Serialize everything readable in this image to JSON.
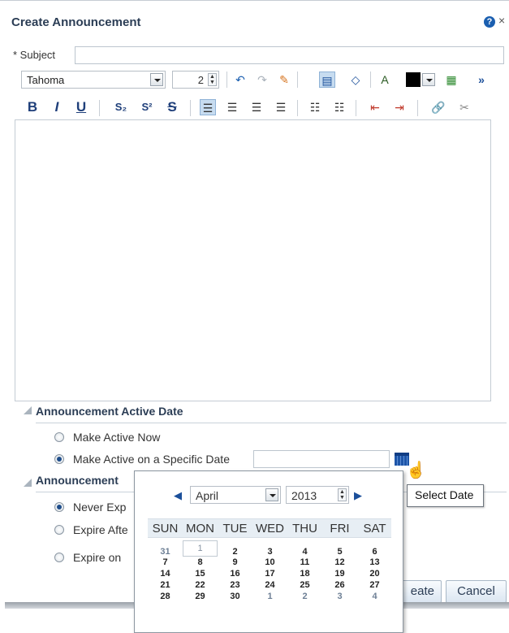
{
  "dialog": {
    "title": "Create Announcement",
    "help_icon": "?",
    "close_icon": "×",
    "subject_label": "* Subject",
    "subject_value": ""
  },
  "toolbar": {
    "font": "Tahoma",
    "size": "2",
    "more": "»",
    "bold": "B",
    "italic": "I",
    "underline": "U",
    "subscript": "S₂",
    "superscript": "S²",
    "strikethrough": "S"
  },
  "active_section": {
    "header": "Announcement Active Date",
    "options": [
      "Make Active Now",
      "Make Active on a Specific Date"
    ],
    "selected_index": 1
  },
  "expire_section": {
    "header": "Announcement",
    "options": [
      "Never Exp",
      "Expire Afte",
      "Expire on"
    ],
    "selected_index": 0
  },
  "tooltip": "Select Date",
  "buttons": {
    "create": "eate",
    "cancel": "Cancel"
  },
  "calendar": {
    "month": "April",
    "year": "2013",
    "days_of_week": [
      "SUN",
      "MON",
      "TUE",
      "WED",
      "THU",
      "FRI",
      "SAT"
    ],
    "weeks": [
      [
        "31",
        "1",
        "2",
        "3",
        "4",
        "5",
        "6"
      ],
      [
        "7",
        "8",
        "9",
        "10",
        "11",
        "12",
        "13"
      ],
      [
        "14",
        "15",
        "16",
        "17",
        "18",
        "19",
        "20"
      ],
      [
        "21",
        "22",
        "23",
        "24",
        "25",
        "26",
        "27"
      ],
      [
        "28",
        "29",
        "30",
        "1",
        "2",
        "3",
        "4"
      ]
    ]
  },
  "colors": {
    "title": "#2b3d55",
    "accent": "#1b5fb0",
    "selected_tool": "#c7dcf0"
  }
}
